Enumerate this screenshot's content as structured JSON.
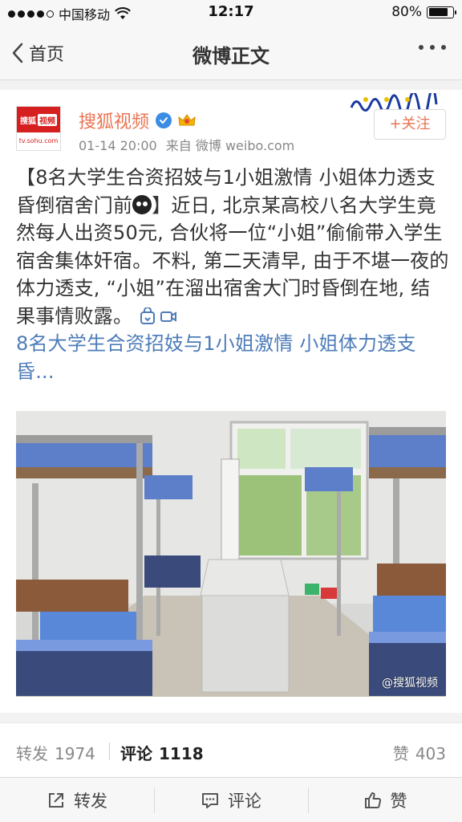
{
  "status": {
    "carrier": "中国移动",
    "time": "12:17",
    "battery": "80%",
    "battery_level": 0.8,
    "signal_bars_filled": 4,
    "signal_bars_total": 5
  },
  "nav": {
    "back_label": "首页",
    "title": "微博正文"
  },
  "post": {
    "avatar_text": "搜狐视频",
    "avatar_url_text": "tv.sohu.com",
    "username": "搜狐视频",
    "timestamp": "01-14 20:00",
    "via_label": "来自 微博 weibo.com",
    "follow_label": "+关注",
    "text_before_emoji": "【8名大学生合资招妓与1小姐激情 小姐体力透支昏倒宿舍门前",
    "text_after_emoji": "】近日, 北京某高校八名大学生竟然每人出资50元, 合伙将一位“小姐”偷偷带入学生宿舍集体奸宿。不料, 第二天清早, 由于不堪一夜的体力透支, “小姐”在溜出宿舍大门时昏倒在地, 结果事情败露。",
    "link_text": "8名大学生合资招妓与1小姐激情 小姐体力透支昏...",
    "image_watermark": "@搜狐视频"
  },
  "stats": {
    "repost_label": "转发",
    "repost_count": "1974",
    "comment_label": "评论",
    "comment_count": "1118",
    "like_label": "赞",
    "like_count": "403"
  },
  "actions": {
    "repost": "转发",
    "comment": "评论",
    "like": "赞"
  },
  "colors": {
    "username": "#eb7350",
    "link": "#4d7cb8",
    "verified": "#3a8ce4"
  }
}
